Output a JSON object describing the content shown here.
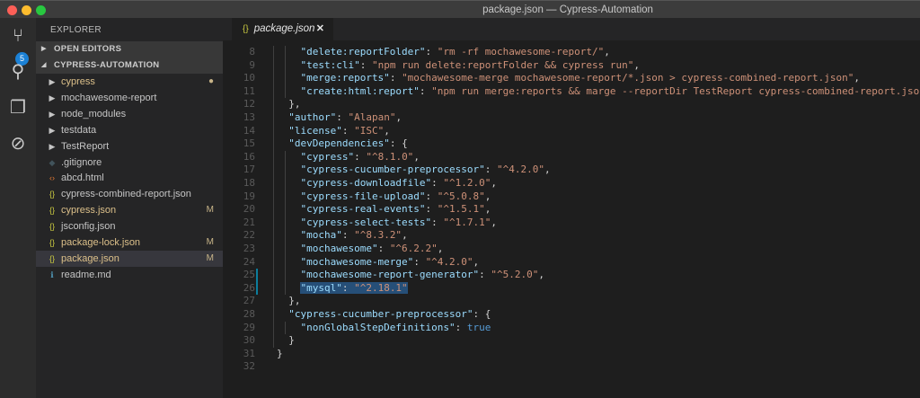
{
  "window": {
    "title": "package.json — Cypress-Automation"
  },
  "activity": {
    "scm_badge": "5",
    "icons": [
      "source-control-icon",
      "search-icon",
      "explorer-icon",
      "debug-icon"
    ]
  },
  "sidebar": {
    "title": "EXPLORER",
    "sections": [
      "OPEN EDITORS",
      "CYPRESS-AUTOMATION"
    ],
    "items": [
      {
        "label": "cypress",
        "type": "folder",
        "status": "●",
        "modified": true
      },
      {
        "label": "mochawesome-report",
        "type": "folder",
        "status": ""
      },
      {
        "label": "node_modules",
        "type": "folder",
        "status": ""
      },
      {
        "label": "testdata",
        "type": "folder",
        "status": ""
      },
      {
        "label": "TestReport",
        "type": "folder",
        "status": ""
      },
      {
        "label": ".gitignore",
        "type": "git",
        "status": ""
      },
      {
        "label": "abcd.html",
        "type": "html",
        "status": ""
      },
      {
        "label": "cypress-combined-report.json",
        "type": "json",
        "status": ""
      },
      {
        "label": "cypress.json",
        "type": "json",
        "status": "M",
        "modified": true
      },
      {
        "label": "jsconfig.json",
        "type": "json",
        "status": ""
      },
      {
        "label": "package-lock.json",
        "type": "json",
        "status": "M",
        "modified": true
      },
      {
        "label": "package.json",
        "type": "json",
        "status": "M",
        "modified": true,
        "selected": true
      },
      {
        "label": "readme.md",
        "type": "info",
        "status": ""
      }
    ]
  },
  "editor": {
    "tab": {
      "label": "package.json",
      "icon": "{}",
      "close": "✕"
    },
    "lines": [
      {
        "n": "8",
        "indent": 2,
        "t": [
          [
            "k",
            "\"delete:reportFolder\""
          ],
          [
            "p",
            ": "
          ],
          [
            "s",
            "\"rm -rf mochawesome-report/\""
          ],
          [
            "p",
            ","
          ]
        ]
      },
      {
        "n": "9",
        "indent": 2,
        "t": [
          [
            "k",
            "\"test:cli\""
          ],
          [
            "p",
            ": "
          ],
          [
            "s",
            "\"npm run delete:reportFolder && cypress run\""
          ],
          [
            "p",
            ","
          ]
        ]
      },
      {
        "n": "10",
        "indent": 2,
        "t": [
          [
            "k",
            "\"merge:reports\""
          ],
          [
            "p",
            ": "
          ],
          [
            "s",
            "\"mochawesome-merge mochawesome-report/*.json > cypress-combined-report.json\""
          ],
          [
            "p",
            ","
          ]
        ]
      },
      {
        "n": "11",
        "indent": 2,
        "t": [
          [
            "k",
            "\"create:html:report\""
          ],
          [
            "p",
            ": "
          ],
          [
            "s",
            "\"npm run merge:reports && marge --reportDir TestReport cypress-combined-report.json\""
          ]
        ]
      },
      {
        "n": "12",
        "indent": 1,
        "t": [
          [
            "p",
            "},"
          ]
        ]
      },
      {
        "n": "13",
        "indent": 1,
        "t": [
          [
            "k",
            "\"author\""
          ],
          [
            "p",
            ": "
          ],
          [
            "s",
            "\"Alapan\""
          ],
          [
            "p",
            ","
          ]
        ]
      },
      {
        "n": "14",
        "indent": 1,
        "t": [
          [
            "k",
            "\"license\""
          ],
          [
            "p",
            ": "
          ],
          [
            "s",
            "\"ISC\""
          ],
          [
            "p",
            ","
          ]
        ]
      },
      {
        "n": "15",
        "indent": 1,
        "t": [
          [
            "k",
            "\"devDependencies\""
          ],
          [
            "p",
            ": {"
          ]
        ]
      },
      {
        "n": "16",
        "indent": 2,
        "t": [
          [
            "k",
            "\"cypress\""
          ],
          [
            "p",
            ": "
          ],
          [
            "s",
            "\"^8.1.0\""
          ],
          [
            "p",
            ","
          ]
        ]
      },
      {
        "n": "17",
        "indent": 2,
        "t": [
          [
            "k",
            "\"cypress-cucumber-preprocessor\""
          ],
          [
            "p",
            ": "
          ],
          [
            "s",
            "\"^4.2.0\""
          ],
          [
            "p",
            ","
          ]
        ]
      },
      {
        "n": "18",
        "indent": 2,
        "t": [
          [
            "k",
            "\"cypress-downloadfile\""
          ],
          [
            "p",
            ": "
          ],
          [
            "s",
            "\"^1.2.0\""
          ],
          [
            "p",
            ","
          ]
        ]
      },
      {
        "n": "19",
        "indent": 2,
        "t": [
          [
            "k",
            "\"cypress-file-upload\""
          ],
          [
            "p",
            ": "
          ],
          [
            "s",
            "\"^5.0.8\""
          ],
          [
            "p",
            ","
          ]
        ]
      },
      {
        "n": "20",
        "indent": 2,
        "t": [
          [
            "k",
            "\"cypress-real-events\""
          ],
          [
            "p",
            ": "
          ],
          [
            "s",
            "\"^1.5.1\""
          ],
          [
            "p",
            ","
          ]
        ]
      },
      {
        "n": "21",
        "indent": 2,
        "t": [
          [
            "k",
            "\"cypress-select-tests\""
          ],
          [
            "p",
            ": "
          ],
          [
            "s",
            "\"^1.7.1\""
          ],
          [
            "p",
            ","
          ]
        ]
      },
      {
        "n": "22",
        "indent": 2,
        "t": [
          [
            "k",
            "\"mocha\""
          ],
          [
            "p",
            ": "
          ],
          [
            "s",
            "\"^8.3.2\""
          ],
          [
            "p",
            ","
          ]
        ]
      },
      {
        "n": "23",
        "indent": 2,
        "t": [
          [
            "k",
            "\"mochawesome\""
          ],
          [
            "p",
            ": "
          ],
          [
            "s",
            "\"^6.2.2\""
          ],
          [
            "p",
            ","
          ]
        ]
      },
      {
        "n": "24",
        "indent": 2,
        "t": [
          [
            "k",
            "\"mochawesome-merge\""
          ],
          [
            "p",
            ": "
          ],
          [
            "s",
            "\"^4.2.0\""
          ],
          [
            "p",
            ","
          ]
        ]
      },
      {
        "n": "25",
        "indent": 2,
        "t": [
          [
            "k",
            "\"mochawesome-report-generator\""
          ],
          [
            "p",
            ": "
          ],
          [
            "s",
            "\"^5.2.0\""
          ],
          [
            "p",
            ","
          ]
        ],
        "changed": true
      },
      {
        "n": "26",
        "indent": 2,
        "t": [
          [
            "k",
            "\"mysql\""
          ],
          [
            "p",
            ": "
          ],
          [
            "s",
            "\"^2.18.1\""
          ]
        ],
        "changed": true,
        "selected": true
      },
      {
        "n": "27",
        "indent": 1,
        "t": [
          [
            "p",
            "},"
          ]
        ]
      },
      {
        "n": "28",
        "indent": 1,
        "t": [
          [
            "k",
            "\"cypress-cucumber-preprocessor\""
          ],
          [
            "p",
            ": {"
          ]
        ]
      },
      {
        "n": "29",
        "indent": 2,
        "t": [
          [
            "k",
            "\"nonGlobalStepDefinitions\""
          ],
          [
            "p",
            ": "
          ],
          [
            "b",
            "true"
          ]
        ]
      },
      {
        "n": "30",
        "indent": 1,
        "t": [
          [
            "p",
            "}"
          ]
        ]
      },
      {
        "n": "31",
        "indent": 0,
        "t": [
          [
            "p",
            "}"
          ]
        ]
      },
      {
        "n": "32",
        "indent": 0,
        "t": []
      }
    ]
  },
  "colors": {
    "accent": "#1b81d6",
    "modified": "#dcc08a",
    "selection": "#264f78"
  }
}
